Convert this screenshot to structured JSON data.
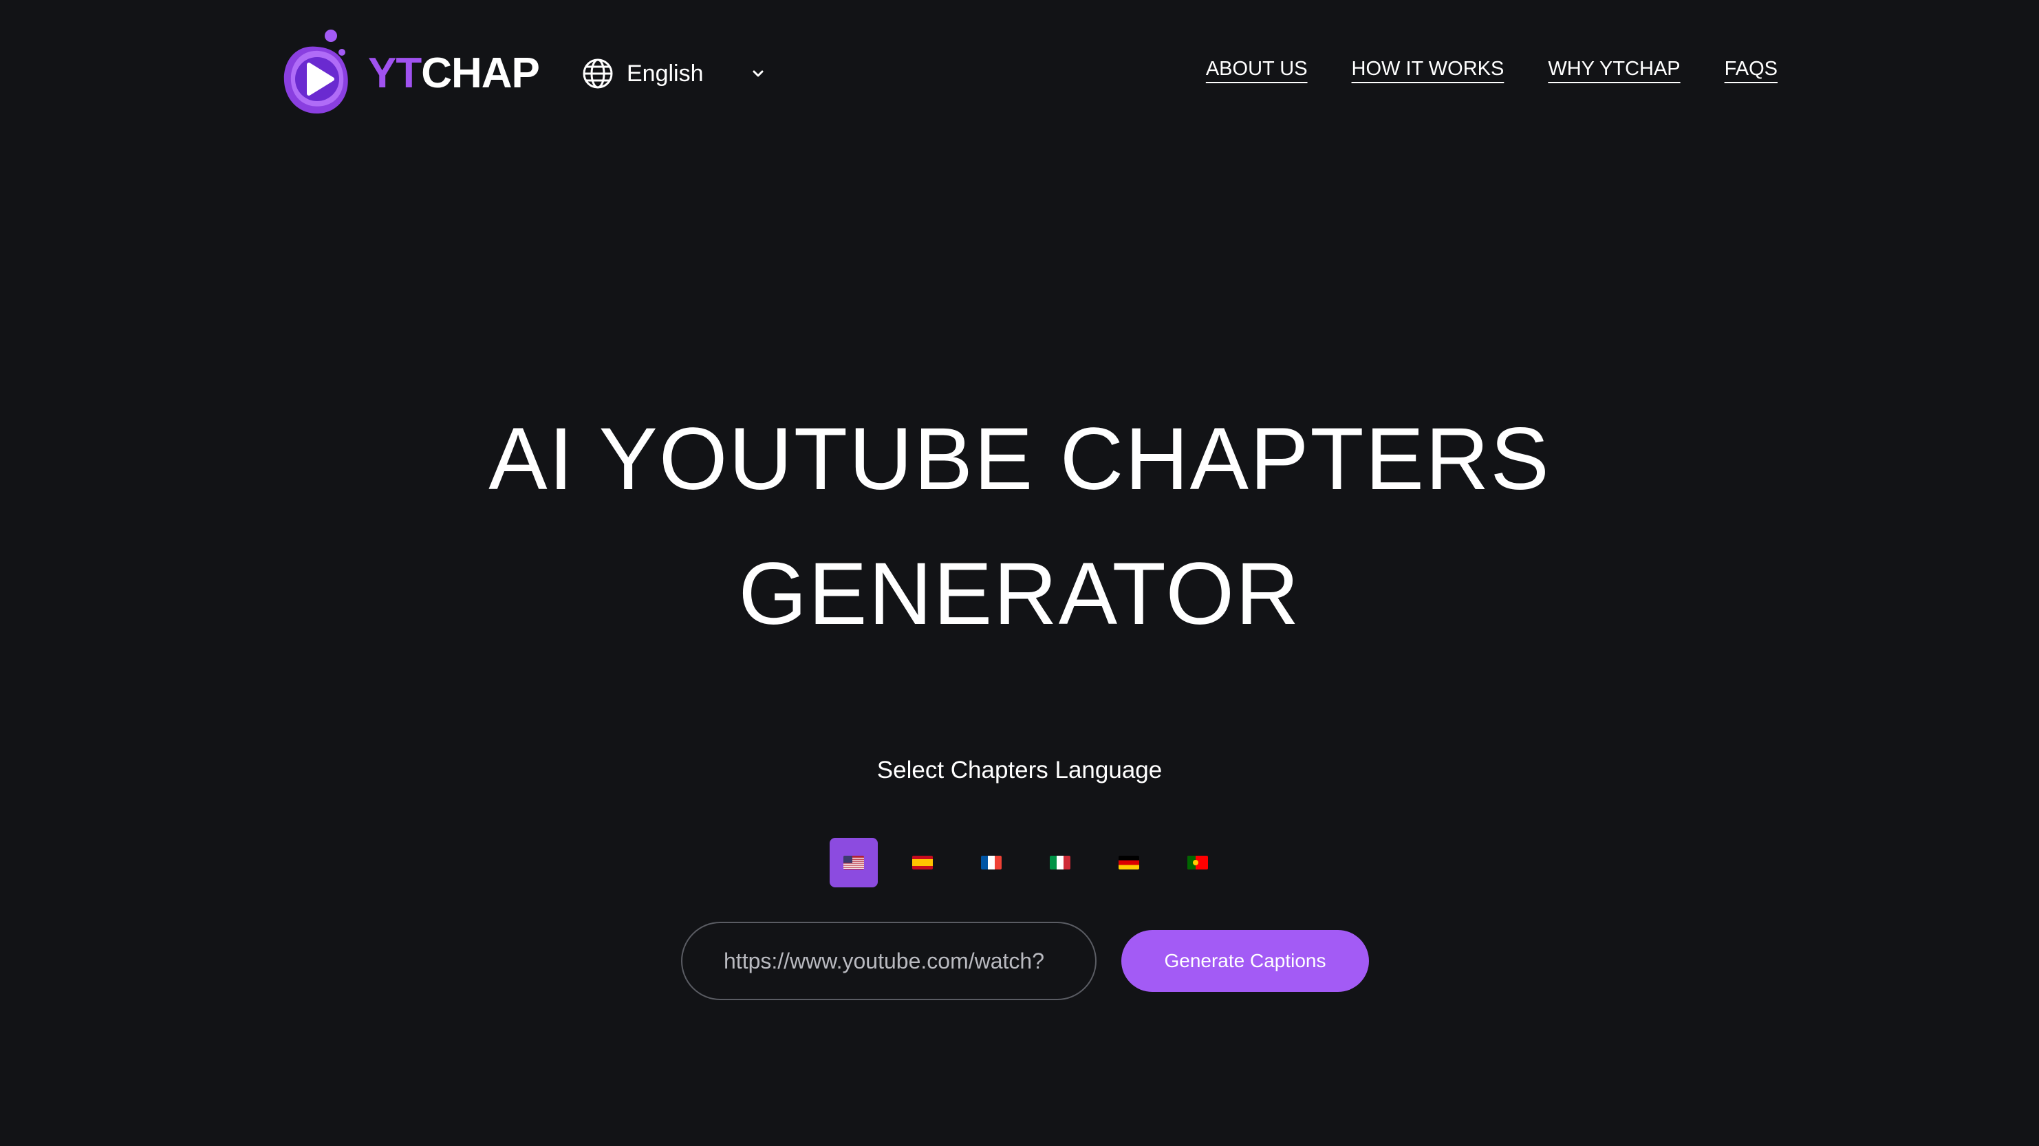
{
  "brand": {
    "name_part1": "YT",
    "name_part2": "CHAP",
    "colors": {
      "accent": "#a35bf5",
      "accent_dark": "#8c4be0",
      "background": "#121316"
    }
  },
  "language_selector": {
    "icon": "globe-icon",
    "selected": "English",
    "chevron": "chevron-down-icon"
  },
  "nav": {
    "items": [
      "ABOUT US",
      "HOW IT WORKS",
      "WHY YTCHAP",
      "FAQS"
    ]
  },
  "hero": {
    "title_line1": "AI YOUTUBE CHAPTERS",
    "title_line2": "GENERATOR"
  },
  "chapters_language": {
    "label": "Select Chapters Language",
    "flags": [
      {
        "name": "us-flag-icon",
        "selected": true
      },
      {
        "name": "es-flag-icon",
        "selected": false
      },
      {
        "name": "fr-flag-icon",
        "selected": false
      },
      {
        "name": "it-flag-icon",
        "selected": false
      },
      {
        "name": "de-flag-icon",
        "selected": false
      },
      {
        "name": "pt-flag-icon",
        "selected": false
      }
    ]
  },
  "form": {
    "url_placeholder": "https://www.youtube.com/watch?",
    "submit_label": "Generate Captions"
  }
}
